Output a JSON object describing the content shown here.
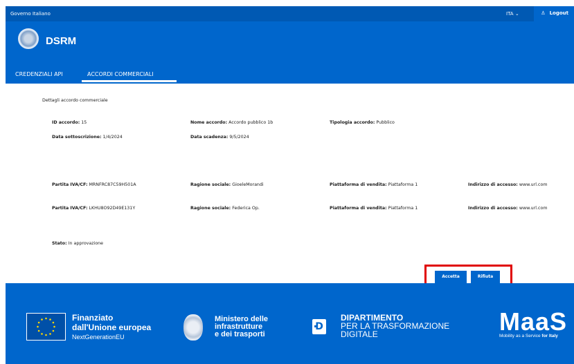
{
  "topbar": {
    "gov_label": "Governo Italiano",
    "language": "ITA",
    "logout_label": "Logout"
  },
  "header": {
    "app_title": "DSRM",
    "tabs": [
      {
        "label": "CREDENZIALI API"
      },
      {
        "label": "ACCORDI COMMERCIALI"
      }
    ]
  },
  "details": {
    "section_title": "Dettagli accordo commerciale",
    "id_label": "ID accordo:",
    "id_value": "15",
    "name_label": "Nome accordo:",
    "name_value": "Accordo pubblico 1b",
    "type_label": "Tipologia accordo:",
    "type_value": "Pubblico",
    "signed_label": "Data sottoscrizione:",
    "signed_value": "1/4/2024",
    "expiry_label": "Data scadenza:",
    "expiry_value": "9/5/2024",
    "parties": [
      {
        "vat_label": "Partita IVA/CF:",
        "vat_value": "MRNFRC87C59H501A",
        "company_label": "Ragione sociale:",
        "company_value": "GioeleMorandi",
        "platform_label": "Piattaforma di vendita:",
        "platform_value": "Piattaforma 1",
        "address_label": "Indirizzo di accesso:",
        "address_value": "www.url.com"
      },
      {
        "vat_label": "Partita IVA/CF:",
        "vat_value": "LKHU8O92D49E131Y",
        "company_label": "Ragione sociale:",
        "company_value": "Federica Op.",
        "platform_label": "Piattaforma di vendita:",
        "platform_value": "Piattaforma 1",
        "address_label": "Indirizzo di accesso:",
        "address_value": "www.url.com"
      }
    ],
    "status_label": "Stato:",
    "status_value": "In approvazione"
  },
  "actions": {
    "accept_label": "Accetta",
    "reject_label": "Rifiuta"
  },
  "footer": {
    "fund_line1": "Finanziato",
    "fund_line2": "dall'Unione europea",
    "fund_line3": "NextGenerationEU",
    "ministry_line1": "Ministero delle",
    "ministry_line2": "infrastrutture",
    "ministry_line3": "e dei trasporti",
    "dept_line1": "DIPARTIMENTO",
    "dept_line2": "PER LA TRASFORMAZIONE",
    "dept_line3": "DIGITALE",
    "maas_logo": "MaaS",
    "maas_tagline": "Mobility as a Service",
    "maas_tagline_bold": "for Italy"
  },
  "colors": {
    "primary": "#0066cc",
    "topbar": "#0059b3",
    "highlight": "#e00000"
  }
}
